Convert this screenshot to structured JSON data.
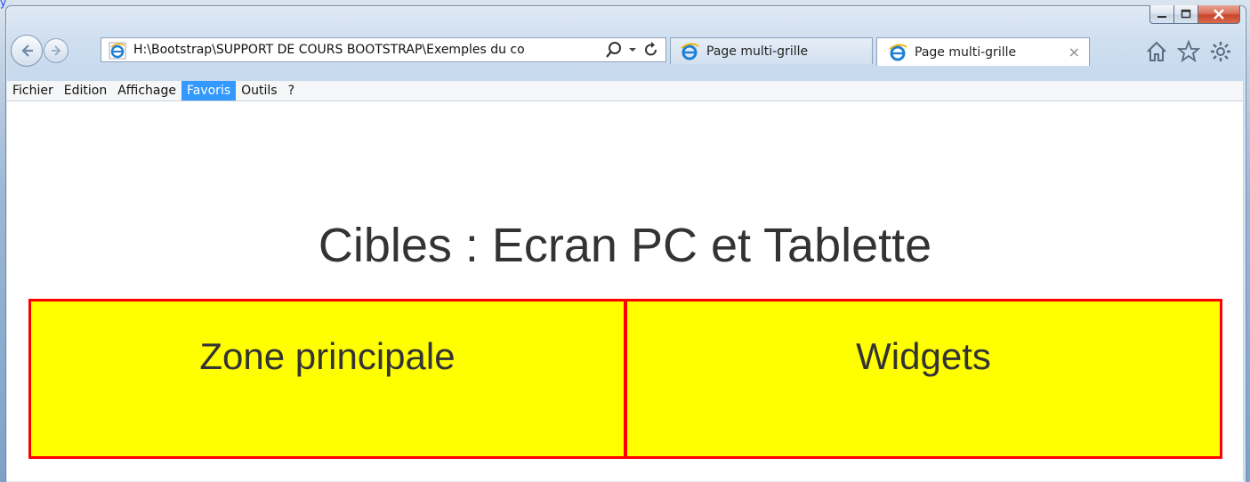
{
  "background": {
    "link_text": "y"
  },
  "browser": {
    "address": "H:\\Bootstrap\\SUPPORT DE COURS BOOTSTRAP\\Exemples du co",
    "tabs": [
      {
        "label": "Page multi-grille",
        "active": false
      },
      {
        "label": "Page multi-grille",
        "active": true
      }
    ],
    "tab_close": "×",
    "menu": [
      "Fichier",
      "Edition",
      "Affichage",
      "Favoris",
      "Outils",
      "?"
    ],
    "active_menu": "Favoris",
    "icons": [
      "back-icon",
      "forward-icon",
      "ie-icon",
      "search-icon",
      "dropdown-icon",
      "refresh-icon",
      "home-icon",
      "favorites-star-icon",
      "settings-gear-icon",
      "minimize-icon",
      "maximize-icon",
      "close-icon"
    ]
  },
  "page": {
    "title": "Cibles : Ecran PC et Tablette",
    "columns": [
      "Zone principale",
      "Widgets"
    ]
  },
  "colors": {
    "column_fill": "#ffff00",
    "column_border": "#ff0000",
    "menu_highlight": "#3399ff",
    "text": "#333333"
  }
}
